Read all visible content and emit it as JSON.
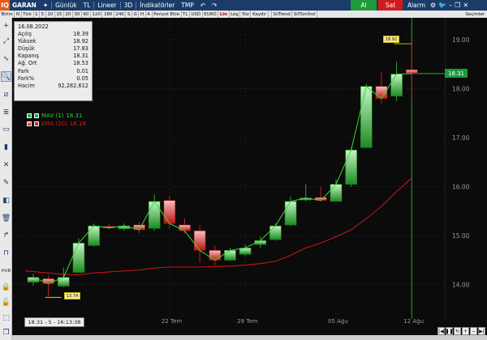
{
  "topbar": {
    "logo": "IQ",
    "symbol": "GARAN",
    "period": "Günlük",
    "currency": "TL",
    "scale": "Lineer",
    "view3d": "3D",
    "indicators": "İndikatörler",
    "tmp": "TMP",
    "buy_label": "Al",
    "sell_label": "Sat",
    "alarm_label": "Alarm"
  },
  "subbar": {
    "cells": [
      "Birim",
      "N",
      "Tick",
      "1",
      "5",
      "10",
      "15",
      "20",
      "30",
      "60",
      "120",
      "180",
      "240",
      "S",
      "G",
      "H",
      "A",
      "Periyot Ekle",
      "TL",
      "USD",
      "EURO",
      "Lin",
      "Log",
      "Yüz",
      "Kaydır",
      "",
      "SilTrend",
      "SilTümİnd"
    ],
    "right": "Seçimler"
  },
  "info": {
    "date": "16.08.2022",
    "rows": [
      {
        "label": "Açılış",
        "value": "18.39"
      },
      {
        "label": "Yüksek",
        "value": "18.92"
      },
      {
        "label": "Düşük",
        "value": "17.83"
      },
      {
        "label": "Kapanış",
        "value": "18.31"
      },
      {
        "label": "Ağ. Ort",
        "value": "18.53"
      },
      {
        "label": "Fark",
        "value": "0.01"
      },
      {
        "label": "Fark%",
        "value": "0.05"
      },
      {
        "label": "Hacim",
        "value": "92,282,612"
      }
    ]
  },
  "legend": {
    "mav_label": "MAV (1)",
    "mav_value": "18.31",
    "ema_label": "EMA (20)",
    "ema_value": "16.18"
  },
  "status": "18.31 - 5 - 16:13:38",
  "last_price_tag": "18.31",
  "mini_tag_high": "18.92",
  "mini_tag_low": "13.74",
  "colors": {
    "up": "#1f9d2c",
    "down": "#d41b1b",
    "ema": "#c61414",
    "mav": "#33dd33",
    "background": "#0b0b0b"
  },
  "chart_data": {
    "type": "candlestick",
    "title": "",
    "ylim": [
      13.3,
      19.45
    ],
    "yticks": [
      14.0,
      15.0,
      16.0,
      17.0,
      18.0,
      19.0
    ],
    "ytick_labels": [
      "14.00",
      "15.00",
      "16.00",
      "17.00",
      "18.00",
      "19.00"
    ],
    "xtick_labels": [
      "22 Tem",
      "29 Tem",
      "05 Ağu",
      "12 Ağu"
    ],
    "xtick_index": [
      9,
      14,
      20,
      25
    ],
    "candles": [
      {
        "o": 14.05,
        "h": 14.22,
        "l": 13.98,
        "c": 14.15
      },
      {
        "o": 14.12,
        "h": 14.2,
        "l": 13.74,
        "c": 14.02
      },
      {
        "o": 13.97,
        "h": 14.35,
        "l": 13.95,
        "c": 14.15
      },
      {
        "o": 14.25,
        "h": 14.95,
        "l": 14.25,
        "c": 14.85
      },
      {
        "o": 14.8,
        "h": 15.25,
        "l": 14.78,
        "c": 15.2
      },
      {
        "o": 15.19,
        "h": 15.25,
        "l": 15.13,
        "c": 15.16
      },
      {
        "o": 15.14,
        "h": 15.25,
        "l": 15.1,
        "c": 15.2
      },
      {
        "o": 15.22,
        "h": 15.28,
        "l": 15.05,
        "c": 15.12
      },
      {
        "o": 15.15,
        "h": 15.85,
        "l": 15.1,
        "c": 15.7
      },
      {
        "o": 15.72,
        "h": 15.82,
        "l": 15.15,
        "c": 15.25
      },
      {
        "o": 15.22,
        "h": 15.35,
        "l": 15.05,
        "c": 15.1
      },
      {
        "o": 15.1,
        "h": 15.22,
        "l": 14.45,
        "c": 14.7
      },
      {
        "o": 14.7,
        "h": 14.8,
        "l": 14.4,
        "c": 14.5
      },
      {
        "o": 14.5,
        "h": 14.75,
        "l": 14.48,
        "c": 14.7
      },
      {
        "o": 14.62,
        "h": 14.82,
        "l": 14.58,
        "c": 14.75
      },
      {
        "o": 14.82,
        "h": 14.98,
        "l": 14.75,
        "c": 14.9
      },
      {
        "o": 14.92,
        "h": 15.25,
        "l": 14.9,
        "c": 15.2
      },
      {
        "o": 15.22,
        "h": 15.8,
        "l": 15.2,
        "c": 15.7
      },
      {
        "o": 15.73,
        "h": 16.05,
        "l": 15.7,
        "c": 15.77
      },
      {
        "o": 15.78,
        "h": 16.0,
        "l": 15.7,
        "c": 15.72
      },
      {
        "o": 15.7,
        "h": 16.15,
        "l": 15.7,
        "c": 16.05
      },
      {
        "o": 16.05,
        "h": 16.8,
        "l": 16.0,
        "c": 16.75
      },
      {
        "o": 16.8,
        "h": 18.1,
        "l": 16.8,
        "c": 18.05
      },
      {
        "o": 18.05,
        "h": 18.35,
        "l": 17.7,
        "c": 17.8
      },
      {
        "o": 17.85,
        "h": 18.55,
        "l": 17.75,
        "c": 18.3
      },
      {
        "o": 18.39,
        "h": 18.92,
        "l": 17.83,
        "c": 18.31
      }
    ],
    "ema_series": {
      "name": "EMA (20)",
      "values": [
        14.28,
        14.24,
        14.21,
        14.2,
        14.24,
        14.26,
        14.28,
        14.3,
        14.34,
        14.36,
        14.36,
        14.36,
        14.37,
        14.38,
        14.4,
        14.43,
        14.48,
        14.6,
        14.75,
        14.85,
        14.98,
        15.12,
        15.35,
        15.6,
        15.9,
        16.18
      ]
    }
  }
}
